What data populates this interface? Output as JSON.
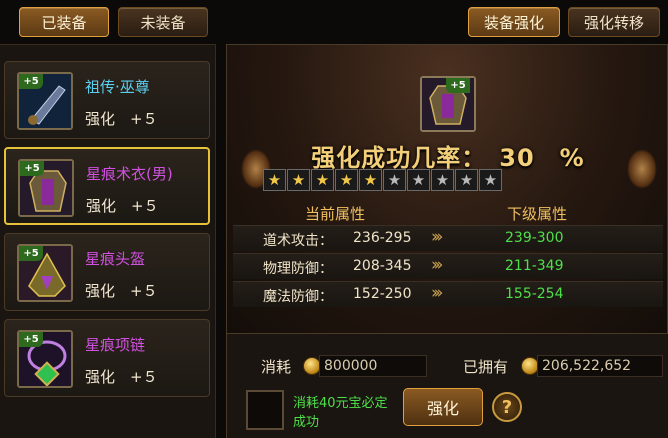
{
  "tabs": {
    "equipped": "已装备",
    "unequipped": "未装备",
    "enhance": "装备强化",
    "transfer": "强化转移"
  },
  "items": [
    {
      "plus": "+5",
      "name": "祖传·巫尊",
      "name_color": "#5ad0f0",
      "level": "强化　+５"
    },
    {
      "plus": "+5",
      "name": "星痕术衣(男)",
      "name_color": "#d050e0",
      "level": "强化　+５"
    },
    {
      "plus": "+5",
      "name": "星痕头盔",
      "name_color": "#d050e0",
      "level": "强化　+５"
    },
    {
      "plus": "+5",
      "name": "星痕项链",
      "name_color": "#d050e0",
      "level": "强化　+５"
    }
  ],
  "enhance_panel": {
    "plus": "+5",
    "success_rate": "强化成功几率：　30　%",
    "stars_total": 10,
    "stars_lit": 5,
    "current_header": "当前属性",
    "next_header": "下级属性",
    "arrow": "›››",
    "stats": [
      {
        "name": "道术攻击：",
        "current": "236-295",
        "next": "239-300"
      },
      {
        "name": "物理防御：",
        "current": "208-345",
        "next": "211-349"
      },
      {
        "name": "魔法防御：",
        "current": "152-250",
        "next": "155-254"
      }
    ]
  },
  "cost": {
    "cost_label": "消耗",
    "cost_value": "800000",
    "owned_label": "已拥有",
    "owned_value": "206,522,652",
    "guarantee": "消耗40元宝必定成功",
    "enhance_button": "强化",
    "help_icon": "?"
  }
}
